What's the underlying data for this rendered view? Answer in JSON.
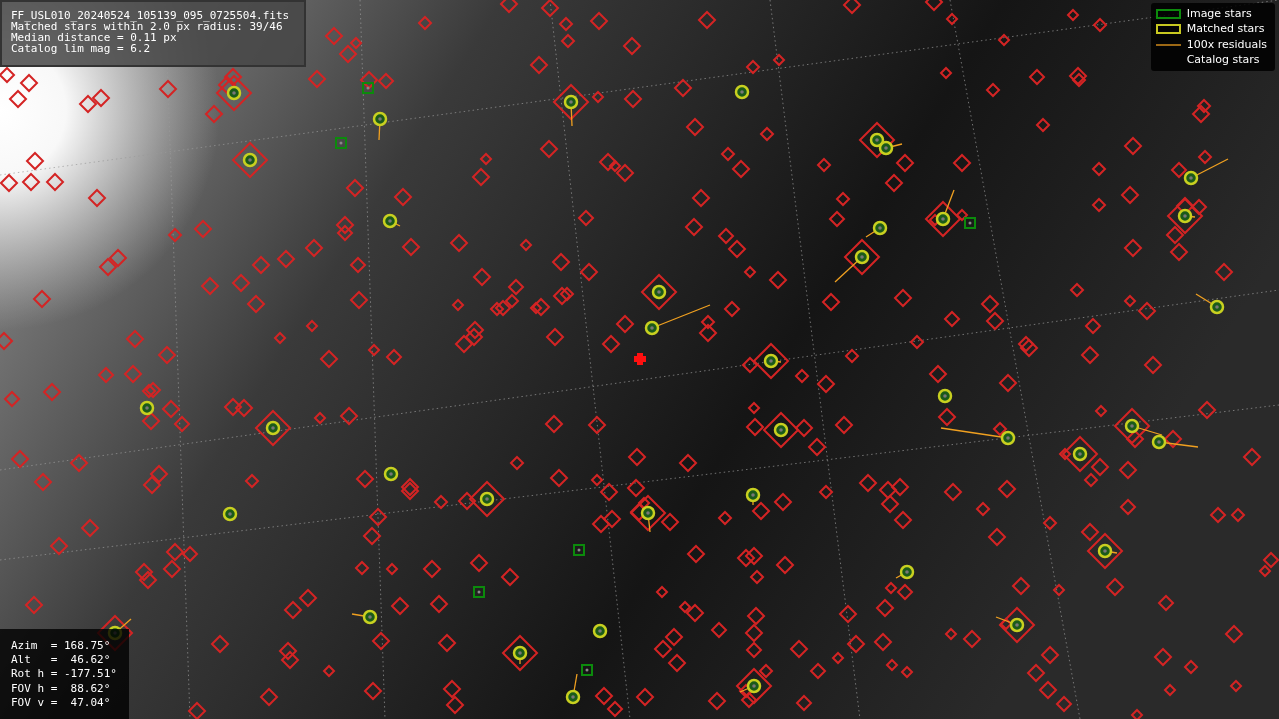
{
  "info_panel": {
    "lines": [
      "FF_USL010_20240524_105139_095_0725504.fits",
      "Matched stars within 2.0 px radius: 39/46",
      "Median distance = 0.11 px",
      "Catalog lim mag = 6.2"
    ]
  },
  "legend": {
    "items": [
      {
        "kind": "image",
        "label": "Image stars"
      },
      {
        "kind": "matched",
        "label": "Matched stars"
      },
      {
        "kind": "residual",
        "label": "100x residuals"
      },
      {
        "kind": "catalog",
        "label": "Catalog stars"
      }
    ]
  },
  "pointing_panel": {
    "rows": [
      {
        "label": "Azim ",
        "value": "= 168.75°"
      },
      {
        "label": "Alt  ",
        "value": "=  46.62°"
      },
      {
        "label": "Rot h",
        "value": "= -177.51°"
      },
      {
        "label": "FOV h",
        "value": "=  88.62°"
      },
      {
        "label": "FOV v",
        "value": "=  47.04°"
      }
    ]
  }
}
